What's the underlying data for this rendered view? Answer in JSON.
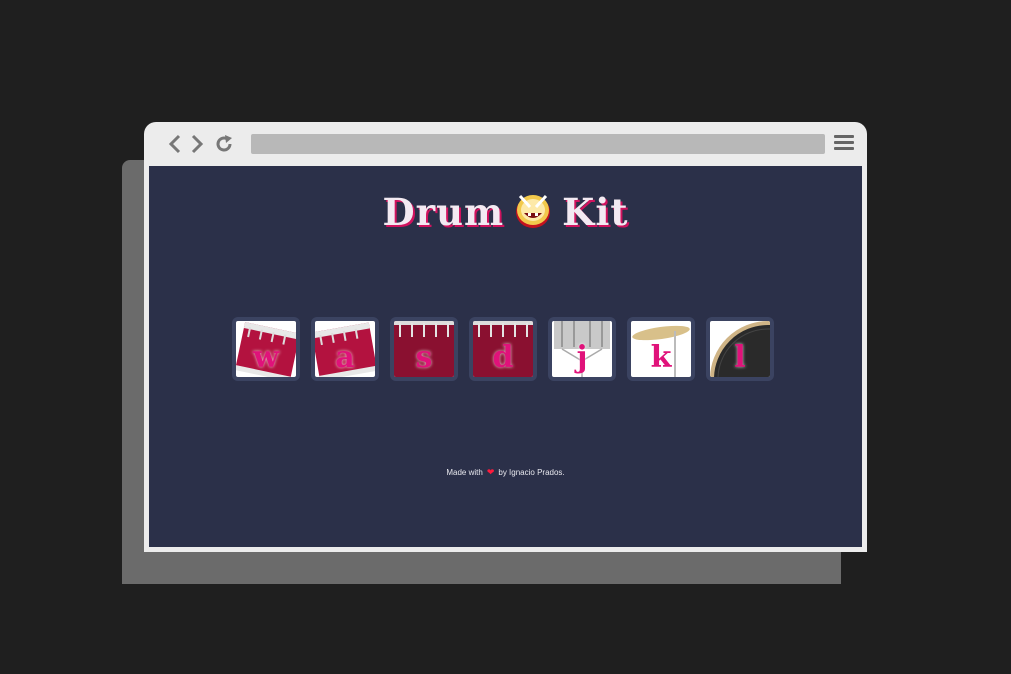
{
  "page": {
    "title_part1": "Drum",
    "title_emoji_icon": "drum-face-emoji-icon",
    "title_part2": "Kit"
  },
  "keys": [
    {
      "letter": "w",
      "image": "tom-drum-tilted"
    },
    {
      "letter": "a",
      "image": "tom-drum-tilted"
    },
    {
      "letter": "s",
      "image": "floor-tom"
    },
    {
      "letter": "d",
      "image": "floor-tom"
    },
    {
      "letter": "j",
      "image": "snare-drum"
    },
    {
      "letter": "k",
      "image": "crash-cymbal"
    },
    {
      "letter": "l",
      "image": "bass-drum"
    }
  ],
  "footer": {
    "made_with": "Made with",
    "heart_icon": "heart-icon",
    "by_text": "by Ignacio Prados."
  },
  "colors": {
    "page_background": "#2b3049",
    "accent": "#e0127a",
    "heart": "#ff1a3c",
    "key_frame": "#3b4361"
  }
}
